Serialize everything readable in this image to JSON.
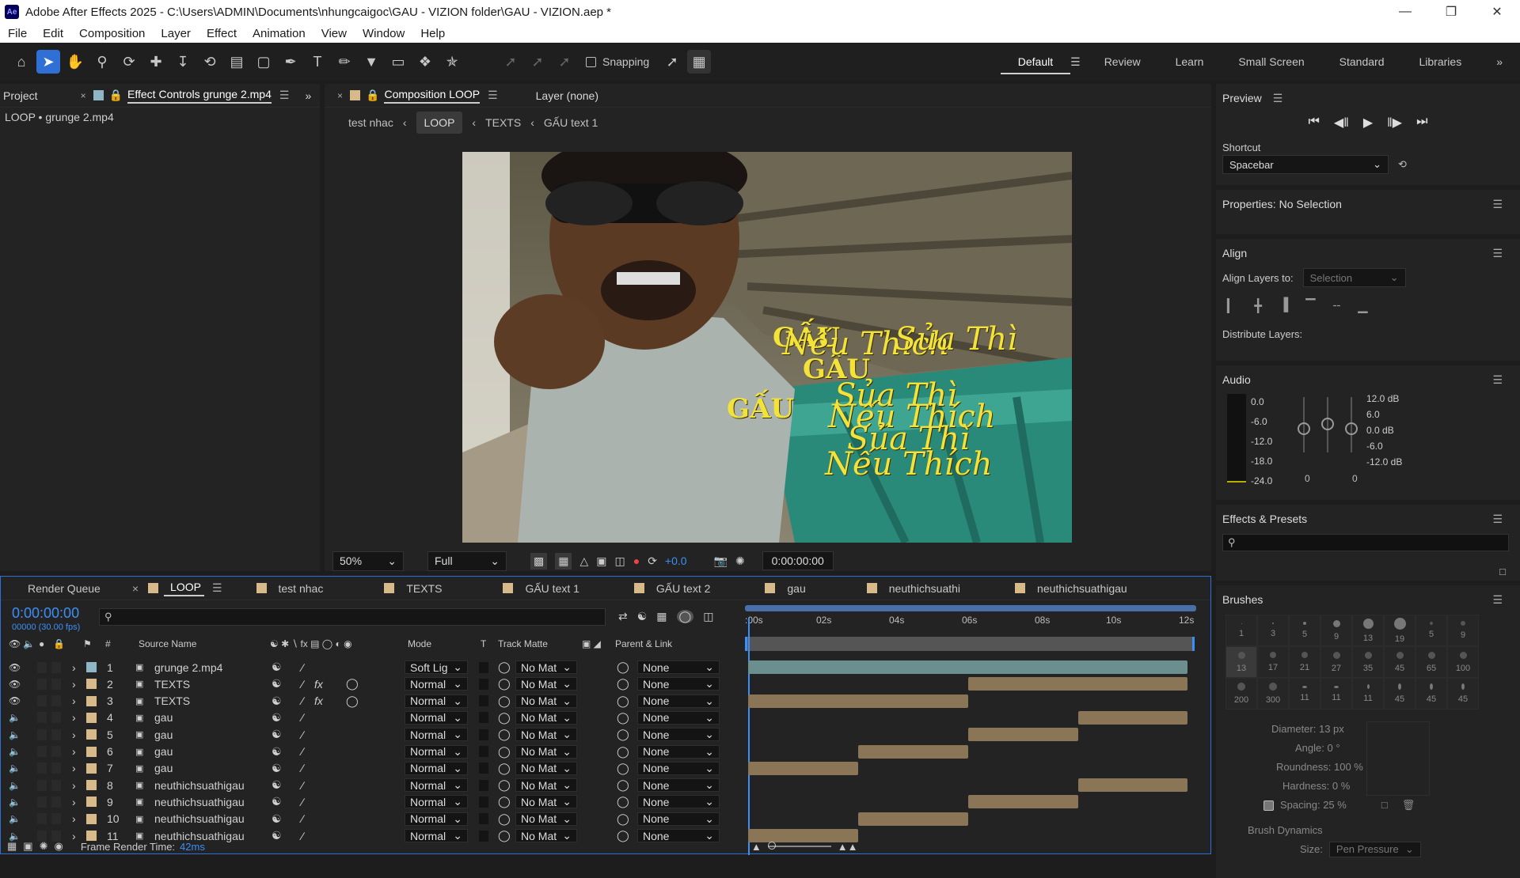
{
  "window": {
    "title": "Adobe After Effects 2025 - C:\\Users\\ADMIN\\Documents\\nhungcaigoc\\GAU - VIZION folder\\GAU - VIZION.aep *",
    "app_icon": "Ae"
  },
  "menu": [
    "File",
    "Edit",
    "Composition",
    "Layer",
    "Effect",
    "Animation",
    "View",
    "Window",
    "Help"
  ],
  "toolbar": {
    "snapping_label": "Snapping"
  },
  "workspaces": [
    "Default",
    "Review",
    "Learn",
    "Small Screen",
    "Standard",
    "Libraries"
  ],
  "left_panel": {
    "tab_project": "Project",
    "tab_effect_controls": "Effect Controls grunge 2.mp4",
    "breadcrumb": "LOOP • grunge 2.mp4"
  },
  "comp_panel": {
    "tab_composition": "Composition LOOP",
    "tab_layer": "Layer (none)",
    "crumbs": [
      "test nhac",
      "LOOP",
      "TEXTS",
      "GẤU text 1"
    ]
  },
  "viewer_overlay": {
    "gau": [
      "GẤU",
      "GẤU",
      "GẤU"
    ],
    "lines": [
      "Nếu Thích",
      "Sủa Thì",
      "Sủa Thì",
      "Nếu Thích",
      "Sủa Thì",
      "Nếu Thích"
    ]
  },
  "viewer_controls": {
    "zoom": "50%",
    "resolution": "Full",
    "exposure": "+0.0",
    "timecode": "0:00:00:00"
  },
  "right_panel": {
    "preview_title": "Preview",
    "shortcut_label": "Shortcut",
    "shortcut_value": "Spacebar",
    "properties_title": "Properties: No Selection",
    "align_title": "Align",
    "align_to_label": "Align Layers to:",
    "align_to_value": "Selection",
    "distribute_label": "Distribute Layers:",
    "audio_title": "Audio",
    "audio_left_scale": [
      "0.0",
      "-6.0",
      "-12.0",
      "-18.0",
      "-24.0"
    ],
    "audio_right_scale": [
      "12.0 dB",
      "6.0",
      "0.0 dB",
      "-6.0",
      "-12.0 dB"
    ],
    "audio_zero_left": "0",
    "audio_zero_right": "0",
    "effects_title": "Effects & Presets",
    "brushes_title": "Brushes",
    "brush_sizes": [
      "1",
      "3",
      "5",
      "9",
      "13",
      "19",
      "5",
      "9",
      "13",
      "17",
      "21",
      "27",
      "35",
      "45",
      "65",
      "100",
      "200",
      "300",
      "11",
      "11",
      "11",
      "45",
      "45",
      "45"
    ],
    "diameter": "Diameter: 13 px",
    "angle": "Angle: 0 °",
    "roundness": "Roundness: 100 %",
    "hardness": "Hardness: 0 %",
    "spacing": "Spacing: 25 %",
    "brush_dynamics": "Brush Dynamics",
    "size_label": "Size:",
    "size_value": "Pen Pressure"
  },
  "timeline": {
    "tabs": [
      "Render Queue",
      "LOOP",
      "test nhac",
      "TEXTS",
      "GẤU text 1",
      "GẤU text 2",
      "gau",
      "neuthichsuathi",
      "neuthichsuathigau"
    ],
    "timecode": "0:00:00:00",
    "fps": "00000 (30.00 fps)",
    "columns": {
      "num": "#",
      "source": "Source Name",
      "mode": "Mode",
      "t": "T",
      "matte": "Track Matte",
      "parent": "Parent & Link"
    },
    "ruler": [
      ":00s",
      "02s",
      "04s",
      "06s",
      "08s",
      "10s",
      "12s"
    ],
    "layers": [
      {
        "num": "1",
        "name": "grunge 2.mp4",
        "mode": "Soft Lig",
        "matte": "No Mat",
        "parent": "None"
      },
      {
        "num": "2",
        "name": "TEXTS",
        "mode": "Normal",
        "matte": "No Mat",
        "parent": "None"
      },
      {
        "num": "3",
        "name": "TEXTS",
        "mode": "Normal",
        "matte": "No Mat",
        "parent": "None"
      },
      {
        "num": "4",
        "name": "gau",
        "mode": "Normal",
        "matte": "No Mat",
        "parent": "None"
      },
      {
        "num": "5",
        "name": "gau",
        "mode": "Normal",
        "matte": "No Mat",
        "parent": "None"
      },
      {
        "num": "6",
        "name": "gau",
        "mode": "Normal",
        "matte": "No Mat",
        "parent": "None"
      },
      {
        "num": "7",
        "name": "gau",
        "mode": "Normal",
        "matte": "No Mat",
        "parent": "None"
      },
      {
        "num": "8",
        "name": "neuthichsuathigau",
        "mode": "Normal",
        "matte": "No Mat",
        "parent": "None"
      },
      {
        "num": "9",
        "name": "neuthichsuathigau",
        "mode": "Normal",
        "matte": "No Mat",
        "parent": "None"
      },
      {
        "num": "10",
        "name": "neuthichsuathigau",
        "mode": "Normal",
        "matte": "No Mat",
        "parent": "None"
      },
      {
        "num": "11",
        "name": "neuthichsuathigau",
        "mode": "Normal",
        "matte": "No Mat",
        "parent": "None"
      }
    ],
    "render_time_label": "Frame Render Time:",
    "render_time_value": "42ms"
  },
  "colors": {
    "accent": "#2f6fd6",
    "timecode": "#3d8ff5",
    "bar": "#8a7557",
    "overlay_text": "#f2e23a"
  }
}
